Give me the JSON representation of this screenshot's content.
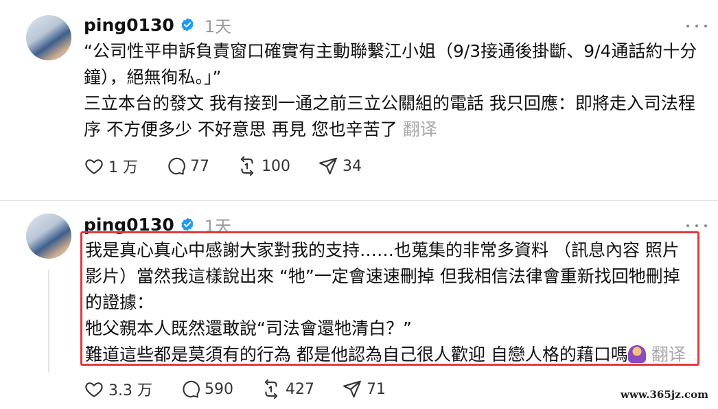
{
  "posts": [
    {
      "username": "ping0130",
      "time": "1天",
      "text": "“公司性平申訴負責窗口確實有主動聯繫江小姐（9/3接通後掛斷、9/4通話約十分鐘），絕無徇私。」”\n三立本台的發文 我有接到一通之前三立公關組的電話 我只回應：即將走入司法程序 不方便多少 不好意思 再見 您也辛苦了",
      "translate": "翻译",
      "likes": "1 万",
      "comments": "77",
      "reposts": "100",
      "shares": "34"
    },
    {
      "username": "ping0130",
      "time": "1天",
      "text": "我是真心真心中感謝大家對我的支持……也蒐集的非常多資料 （訊息內容 照片 影片）當然我這樣說出來 “牠”一定會速速刪掉 但我相信法律會重新找回牠刪掉的證據：\n牠父親本人既然還敢說“司法會還牠清白？”\n難道這些都是莫須有的行為 都是他認為自己很人歡迎 自戀人格的藉口嗎",
      "translate": "翻译",
      "likes": "3.3 万",
      "comments": "590",
      "reposts": "427",
      "shares": "71"
    }
  ],
  "icons": {
    "verified": "verified-badge-icon",
    "more": "more-options-icon",
    "like": "heart-icon",
    "comment": "comment-bubble-icon",
    "repost": "repost-icon",
    "share": "send-icon",
    "emoji": "person-shrugging-emoji"
  },
  "colors": {
    "verified": "#1d9bf0",
    "highlight_border": "#e0393e",
    "muted_text": "#9a9a9a"
  },
  "watermark": "www.365jz.com"
}
